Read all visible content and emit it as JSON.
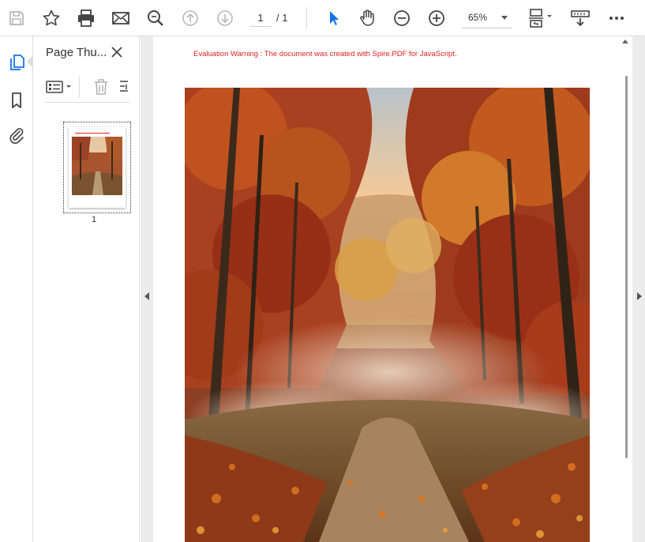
{
  "toolbar": {
    "current_page": "1",
    "total_pages": "/ 1",
    "zoom": "65%"
  },
  "thumbnails": {
    "panel_title": "Page Thu...",
    "items": [
      {
        "label": "1"
      }
    ]
  },
  "document": {
    "evaluation_warning": "Evaluation Warning : The document was created with Spire.PDF for JavaScript."
  },
  "colors": {
    "accent": "#1473e6",
    "warning": "#e02020"
  }
}
